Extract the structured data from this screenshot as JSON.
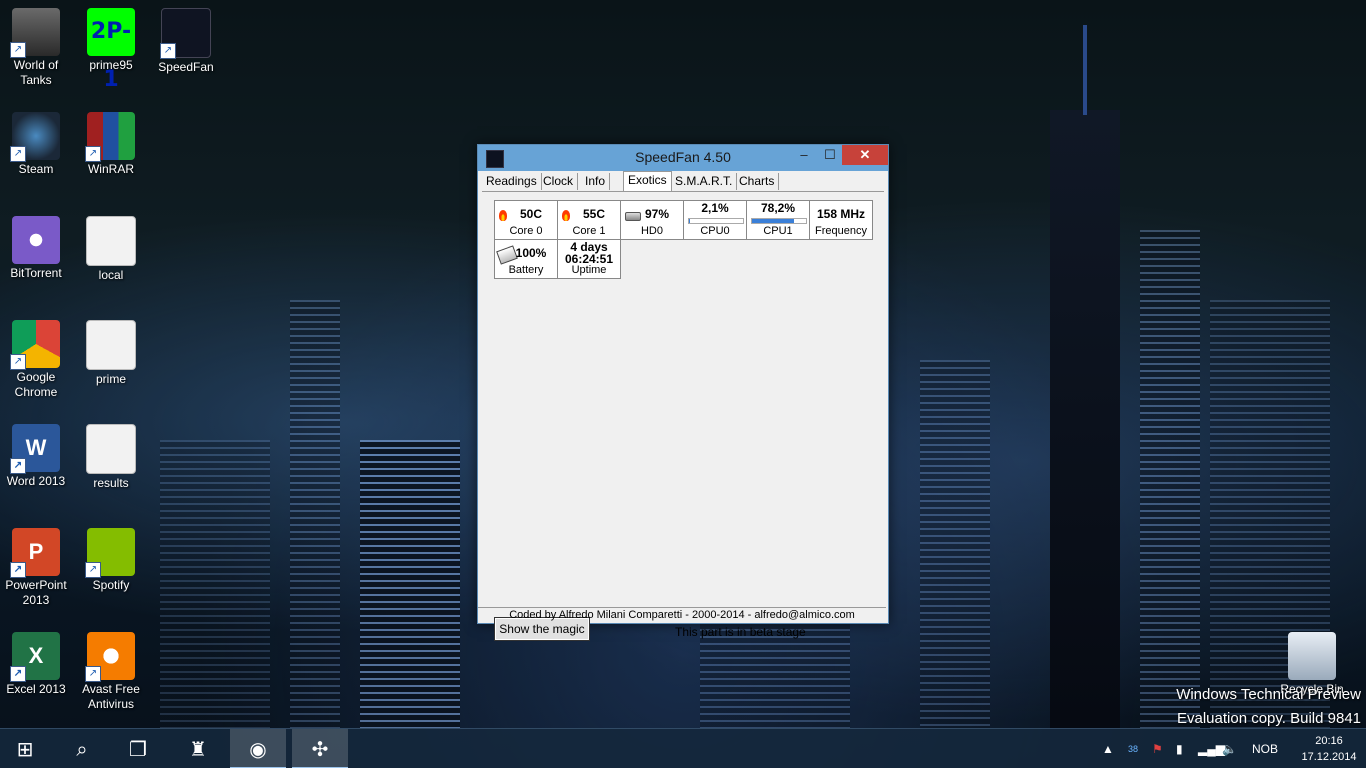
{
  "desktop": {
    "icons": [
      {
        "label": "World of Tanks"
      },
      {
        "label": "prime95",
        "glyph_text": "2P-1"
      },
      {
        "label": "SpeedFan"
      },
      {
        "label": "Steam"
      },
      {
        "label": "WinRAR"
      },
      {
        "label": "BitTorrent"
      },
      {
        "label": "local"
      },
      {
        "label": "Google Chrome"
      },
      {
        "label": "prime"
      },
      {
        "label": "Word 2013",
        "glyph_text": "W"
      },
      {
        "label": "results"
      },
      {
        "label": "PowerPoint 2013",
        "glyph_text": "P"
      },
      {
        "label": "Spotify"
      },
      {
        "label": "Excel 2013",
        "glyph_text": "X"
      },
      {
        "label": "Avast Free Antivirus"
      },
      {
        "label": "Recycle Bin"
      }
    ]
  },
  "speedfan": {
    "title": "SpeedFan 4.50",
    "window_buttons": {
      "minimize": "–",
      "maximize": "☐",
      "close": "✕"
    },
    "tabs": [
      {
        "label": "Readings"
      },
      {
        "label": "Clock"
      },
      {
        "label": "Info"
      },
      {
        "label": "Exotics",
        "active": true
      },
      {
        "label": "S.M.A.R.T."
      },
      {
        "label": "Charts"
      }
    ],
    "cells": [
      {
        "value": "50C",
        "label": "Core 0",
        "icon": "flame-icon"
      },
      {
        "value": "55C",
        "label": "Core 1",
        "icon": "flame-icon"
      },
      {
        "value": "97%",
        "label": "HD0",
        "icon": "hard-drive-icon"
      },
      {
        "value": "2,1%",
        "label": "CPU0",
        "usage_fraction": 0.021
      },
      {
        "value": "78,2%",
        "label": "CPU1",
        "usage_fraction": 0.782
      },
      {
        "value": "158 MHz",
        "label": "Frequency"
      },
      {
        "value": "100%",
        "label": "Battery",
        "icon": "battery-icon"
      },
      {
        "value_line1": "4 days",
        "value_line2": "06:24:51",
        "label": "Uptime"
      }
    ],
    "magic_button": "Show the magic",
    "beta_note": "This part is in beta stage",
    "status_bar": "Coded by Alfredo Milani Comparetti - 2000-2014 - alfredo@almico.com"
  },
  "watermark": {
    "line1": "Windows Technical Preview",
    "line2": "Evaluation copy. Build 9841"
  },
  "taskbar": {
    "tray_language": "NOB",
    "tray_badge": "38",
    "clock_time": "20:16",
    "clock_date": "17.12.2014",
    "colors": {
      "accent": "#9cc4ec",
      "bar": "#14283c"
    }
  }
}
